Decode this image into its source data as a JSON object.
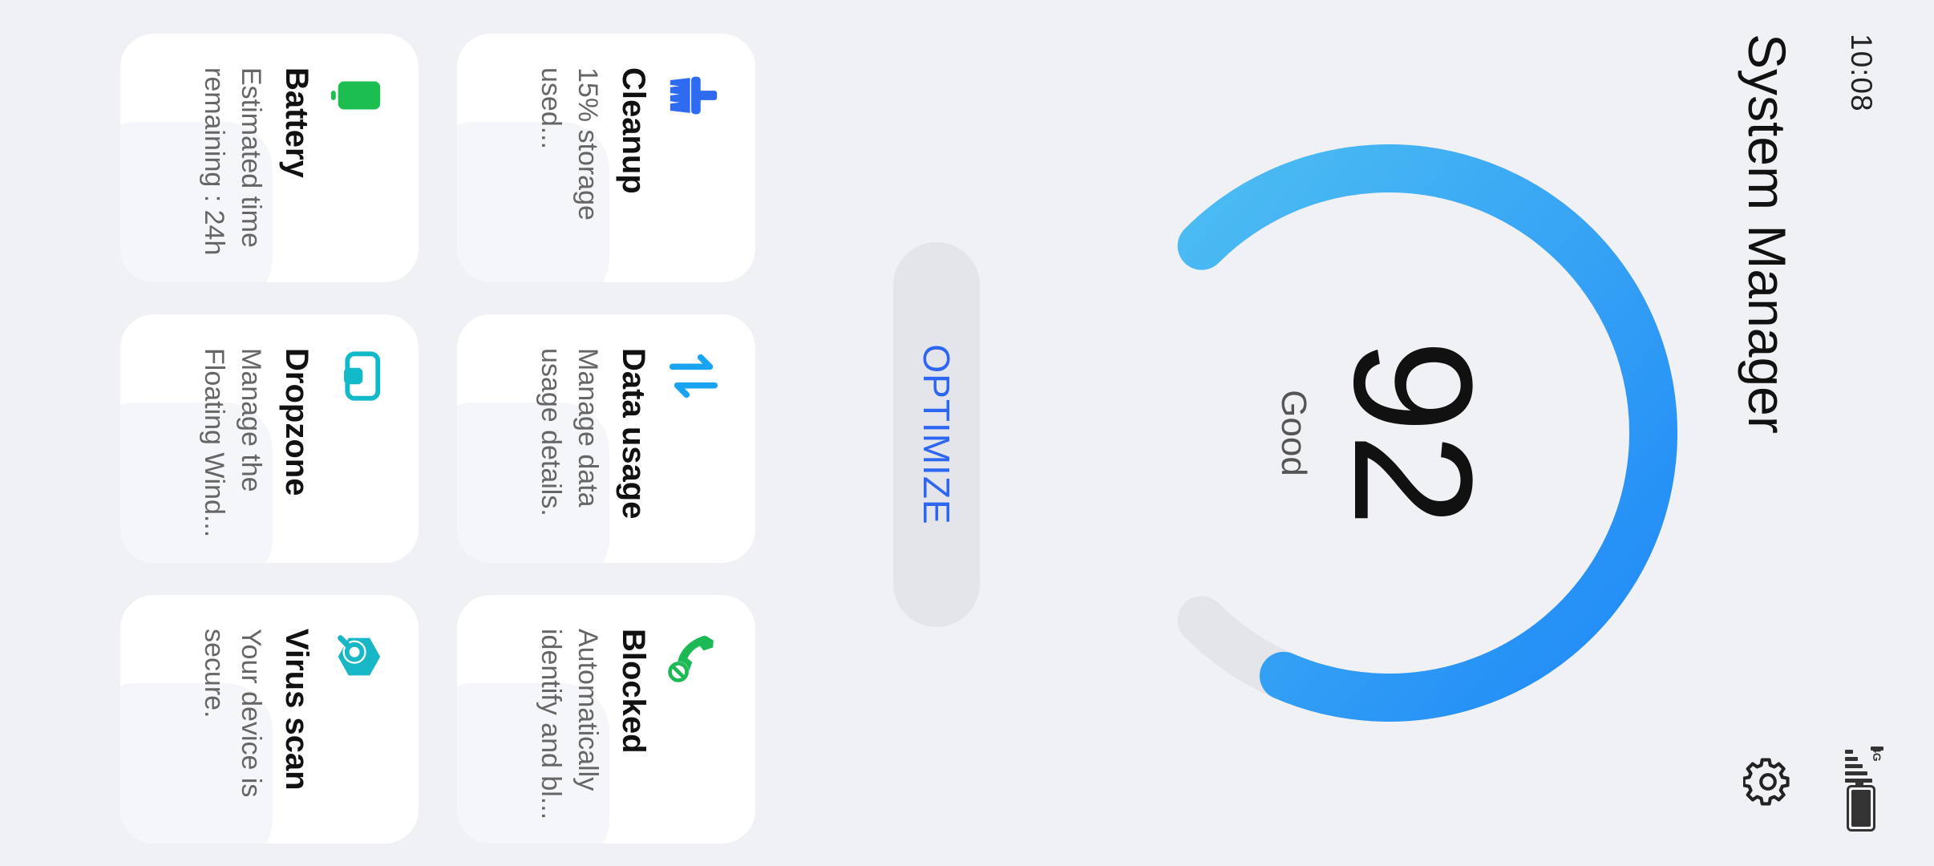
{
  "status_bar": {
    "time": "10:08",
    "network": "4G"
  },
  "header": {
    "title": "System Manager"
  },
  "score": {
    "value": "92",
    "label": "Good",
    "fraction": 0.92
  },
  "actions": {
    "optimize_label": "OPTIMIZE"
  },
  "colors": {
    "accent": "#2d66f0",
    "gauge_start": "#4dbdf2",
    "gauge_end": "#1e88f7",
    "gauge_track": "#e4e5e9",
    "cleanup_icon": "#2e6bf0",
    "data_icon": "#1aa3f0",
    "blocked_icon": "#1db954",
    "battery_icon": "#1cbf4f",
    "dropzone_icon": "#12b9c9",
    "virus_icon": "#17b7c6"
  },
  "cards": [
    {
      "title": "Cleanup",
      "desc": "15% storage used...",
      "icon": "broom-icon"
    },
    {
      "title": "Data usage",
      "desc": "Manage data usage details.",
      "icon": "data-transfer-icon"
    },
    {
      "title": "Blocked",
      "desc": "Automatically identify and bl...",
      "icon": "blocked-call-icon"
    },
    {
      "title": "Battery",
      "desc": "Estimated time remaining : 24h",
      "icon": "battery-icon"
    },
    {
      "title": "Dropzone",
      "desc": "Manage the Floating Wind...",
      "icon": "dropzone-icon"
    },
    {
      "title": "Virus scan",
      "desc": "Your device is secure.",
      "icon": "virus-scan-icon"
    }
  ]
}
